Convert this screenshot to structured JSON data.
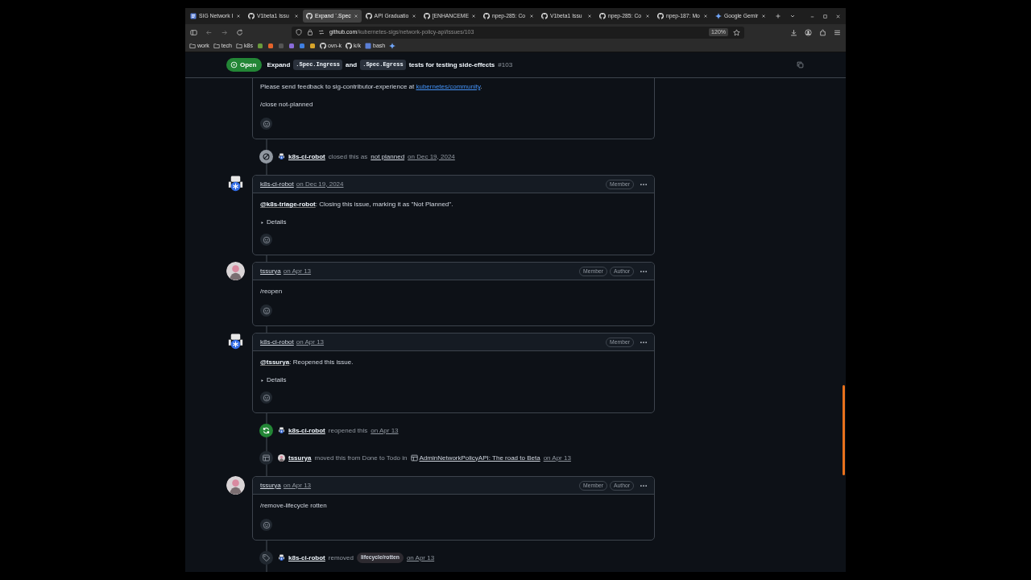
{
  "browser": {
    "tabs": [
      {
        "title": "SIG Network I",
        "kind": "doc",
        "selected": false
      },
      {
        "title": "V1beta1 Issu",
        "kind": "github",
        "selected": false
      },
      {
        "title": "Expand `.Spec",
        "kind": "github",
        "selected": true
      },
      {
        "title": "API Graduatio",
        "kind": "github",
        "selected": false
      },
      {
        "title": "[ENHANCEME",
        "kind": "github",
        "selected": false
      },
      {
        "title": "npep-285: Co",
        "kind": "github",
        "selected": false
      },
      {
        "title": "V1beta1 Issu",
        "kind": "github",
        "selected": false
      },
      {
        "title": "npep-285: Co",
        "kind": "github",
        "selected": false
      },
      {
        "title": "npep-187: Mo",
        "kind": "github",
        "selected": false
      },
      {
        "title": "Google Gemir",
        "kind": "sparkle",
        "selected": false
      }
    ],
    "address": {
      "host": "github.com",
      "path": "/kubernetes-sigs/network-policy-api/issues/103"
    },
    "zoom": "120%",
    "bookmarks": [
      {
        "kind": "folder",
        "label": "work"
      },
      {
        "kind": "folder",
        "label": "tech"
      },
      {
        "kind": "folder",
        "label": "k8s"
      },
      {
        "kind": "icon",
        "color": "#6a9b3c"
      },
      {
        "kind": "icon",
        "color": "#e5632a"
      },
      {
        "kind": "icon",
        "color": "#555555"
      },
      {
        "kind": "icon",
        "color": "#8a6cd8"
      },
      {
        "kind": "icon",
        "color": "#3f7fe0"
      },
      {
        "kind": "icon",
        "color": "#d9a52a"
      },
      {
        "kind": "github",
        "label": "ovn-k"
      },
      {
        "kind": "github",
        "label": "k/k"
      },
      {
        "kind": "app",
        "label": "bash",
        "color": "#5b7fd6"
      },
      {
        "kind": "sparkle"
      }
    ]
  },
  "issue": {
    "state": "Open",
    "title": [
      {
        "text": "Expand",
        "code": false
      },
      {
        "text": ".Spec.Ingress",
        "code": true
      },
      {
        "text": "and",
        "code": false
      },
      {
        "text": ".Spec.Egress",
        "code": true
      },
      {
        "text": "tests for testing side-effects",
        "code": false
      }
    ],
    "number": "#103"
  },
  "timeline": [
    {
      "kind": "comment",
      "paragraphs": [
        [
          {
            "kind": "plain",
            "text": "Please send feedback to sig-contributor-experience at "
          },
          {
            "kind": "link",
            "text": "kubernetes/community"
          },
          {
            "kind": "plain",
            "text": "."
          }
        ],
        [
          {
            "kind": "plain",
            "text": "/close not-planned"
          }
        ]
      ]
    },
    {
      "kind": "closed",
      "actor": {
        "name": "k8s-ci-robot",
        "kind": "bot"
      },
      "parts": [
        {
          "kind": "muted",
          "text": "closed this as"
        },
        {
          "kind": "reason",
          "text": "not planned"
        },
        {
          "kind": "date",
          "text": "on Dec 19, 2024"
        }
      ]
    },
    {
      "kind": "comment",
      "author": {
        "name": "k8s-ci-robot",
        "kind": "bot"
      },
      "date": "on Dec 19, 2024",
      "badges": [
        "Member"
      ],
      "paragraphs": [
        [
          {
            "kind": "mention",
            "text": "@k8s-triage-robot"
          },
          {
            "kind": "plain",
            "text": ": Closing this issue, marking it as \"Not Planned\"."
          }
        ]
      ],
      "details": "Details"
    },
    {
      "kind": "comment",
      "author": {
        "name": "tssurya",
        "kind": "user"
      },
      "date": "on Apr 13",
      "badges": [
        "Member",
        "Author"
      ],
      "paragraphs": [
        [
          {
            "kind": "plain",
            "text": "/reopen"
          }
        ]
      ]
    },
    {
      "kind": "comment",
      "author": {
        "name": "k8s-ci-robot",
        "kind": "bot"
      },
      "date": "on Apr 13",
      "badges": [
        "Member"
      ],
      "paragraphs": [
        [
          {
            "kind": "mention",
            "text": "@tssurya"
          },
          {
            "kind": "plain",
            "text": ": Reopened this issue."
          }
        ]
      ],
      "details": "Details"
    },
    {
      "kind": "reopened",
      "actor": {
        "name": "k8s-ci-robot",
        "kind": "bot"
      },
      "parts": [
        {
          "kind": "muted",
          "text": "reopened this"
        },
        {
          "kind": "date",
          "text": "on Apr 13"
        }
      ]
    },
    {
      "kind": "moved",
      "actor": {
        "name": "tssurya",
        "kind": "user"
      },
      "parts": [
        {
          "kind": "muted",
          "text": "moved this from Done to Todo in"
        },
        {
          "kind": "project",
          "text": "AdminNetworkPolicyAPI: The road to Beta"
        },
        {
          "kind": "date",
          "text": "on Apr 13"
        }
      ]
    },
    {
      "kind": "comment",
      "author": {
        "name": "tssurya",
        "kind": "user"
      },
      "date": "on Apr 13",
      "badges": [
        "Member",
        "Author"
      ],
      "paragraphs": [
        [
          {
            "kind": "plain",
            "text": "/remove-lifecycle rotten"
          }
        ]
      ]
    },
    {
      "kind": "unlabeled",
      "actor": {
        "name": "k8s-ci-robot",
        "kind": "bot"
      },
      "parts": [
        {
          "kind": "muted",
          "text": "removed"
        },
        {
          "kind": "label",
          "text": "lifecycle/rotten"
        },
        {
          "kind": "date",
          "text": "on Apr 13"
        }
      ]
    }
  ]
}
